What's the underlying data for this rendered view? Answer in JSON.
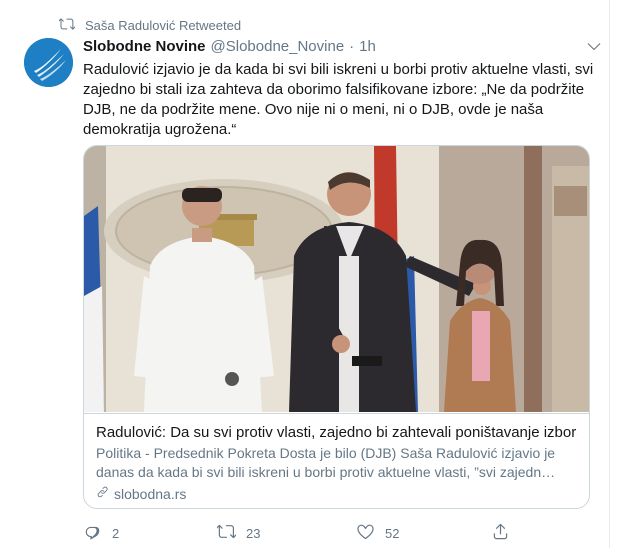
{
  "retweet": {
    "label": "Saša Radulović Retweeted",
    "icon": "retweet-icon"
  },
  "tweet": {
    "author_name": "Slobodne Novine",
    "handle": "@Slobodne_Novine",
    "separator": "·",
    "time": "1h",
    "text": "Radulović izjavio je da kada bi svi bili iskreni u borbi protiv aktuelne vlasti, svi zajedno bi stali iza zahteva da oborimo falsifikovane izbore: „Ne da podržite DJB, ne da podržite mene. Ovo nije ni o meni, ni o DJB, ovde je naša demokratija ugrožena.“"
  },
  "card": {
    "title": "Radulović: Da su svi protiv vlasti, zajedno bi zahtevali poništavanje izbora",
    "description": "Politika - Predsednik Pokreta Dosta je bilo (DJB) Saša Radulović izjavio je danas da kada bi svi bili iskreni u borbi protiv aktuelne vlasti, ”svi zajedn…",
    "domain": "slobodna.rs",
    "domain_icon": "link-icon"
  },
  "actions": {
    "reply_count": "2",
    "retweet_count": "23",
    "like_count": "52"
  },
  "colors": {
    "secondary_text": "#657786",
    "border": "#ccd6dd",
    "avatar_blue": "#1e7fc4"
  }
}
